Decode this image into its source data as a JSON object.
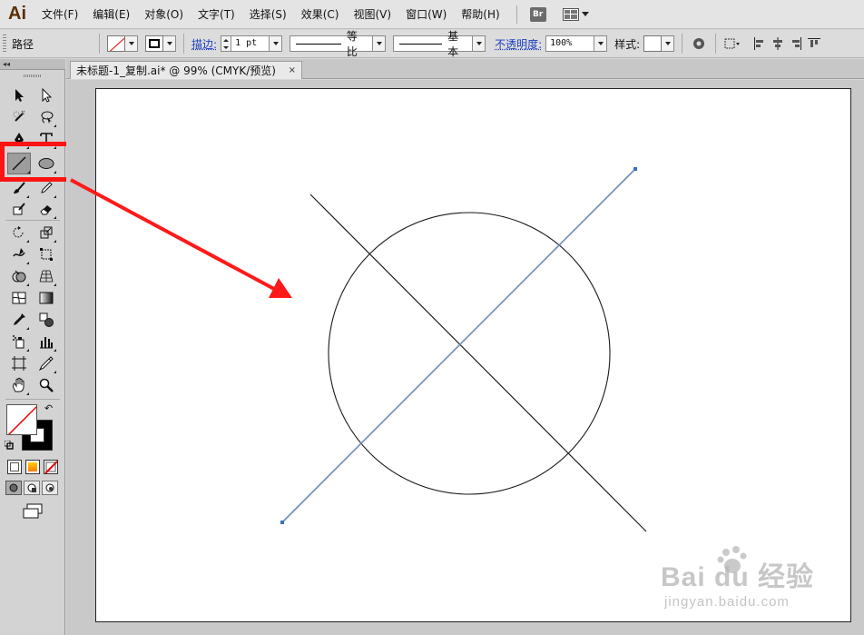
{
  "app": {
    "logo": "Ai"
  },
  "menu": {
    "items": [
      "文件(F)",
      "编辑(E)",
      "对象(O)",
      "文字(T)",
      "选择(S)",
      "效果(C)",
      "视图(V)",
      "窗口(W)",
      "帮助(H)"
    ],
    "bridge_label": "Br"
  },
  "control_bar": {
    "selection_type": "路径",
    "stroke_label": "描边:",
    "stroke_weight": "1 pt",
    "profile_label": "等比",
    "brush_label": "基本",
    "opacity_label": "不透明度:",
    "opacity_value": "100%",
    "style_label": "样式:"
  },
  "tools_header": "◂◂",
  "document": {
    "tab_title": "未标题-1_复制.ai* @ 99% (CMYK/预览)",
    "close_label": "×"
  },
  "watermark": {
    "brand": "Bai du 经验",
    "url": "jingyan.baidu.com"
  },
  "colors": {
    "highlight": "#ff1212",
    "selected_path": "#6f8db5",
    "shape_stroke": "#1a1a1a",
    "arrow": "#ff1a1a"
  },
  "icons": {
    "selection": "selection-tool-icon",
    "direct_selection": "direct-selection-tool-icon",
    "magic_wand": "magic-wand-icon",
    "lasso": "lasso-icon",
    "pen": "pen-icon",
    "type": "type-icon",
    "line": "line-segment-icon",
    "ellipse": "ellipse-icon",
    "brush": "paintbrush-icon",
    "pencil": "pencil-icon",
    "blob": "blob-brush-icon",
    "eraser": "eraser-icon",
    "rotate": "rotate-icon",
    "scale": "scale-icon",
    "warp": "warp-icon",
    "free_transform": "free-transform-icon",
    "shape_builder": "shape-builder-icon",
    "perspective": "perspective-grid-icon",
    "mesh": "mesh-icon",
    "gradient": "gradient-icon",
    "eyedropper": "eyedropper-icon",
    "blend": "blend-icon",
    "symbol": "symbol-sprayer-icon",
    "graph": "column-graph-icon",
    "artboard": "artboard-icon",
    "slice": "slice-icon",
    "hand": "hand-icon",
    "zoom": "zoom-icon"
  }
}
